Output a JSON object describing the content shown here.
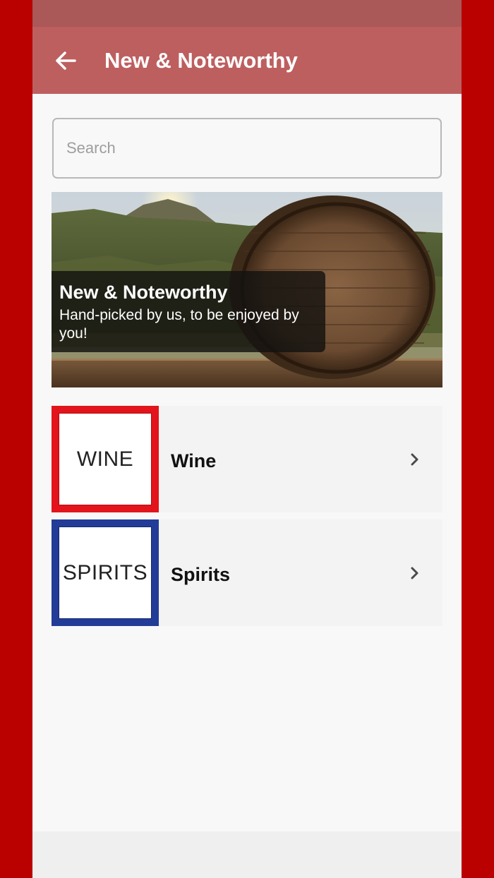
{
  "header": {
    "title": "New & Noteworthy",
    "back_icon": "arrow-left-icon"
  },
  "search": {
    "placeholder": "Search",
    "value": ""
  },
  "banner": {
    "title": "New & Noteworthy",
    "subtitle": "Hand-picked by us, to be enjoyed by you!"
  },
  "categories": [
    {
      "label": "Wine",
      "thumb_text": "WINE",
      "border_color": "#e3141c"
    },
    {
      "label": "Spirits",
      "thumb_text": "SPIRITS",
      "border_color": "#233c98"
    }
  ],
  "colors": {
    "frame": "#bb0000",
    "status_bar": "#aa5858",
    "app_bar": "#bd5f5f",
    "background": "#f8f8f8"
  }
}
